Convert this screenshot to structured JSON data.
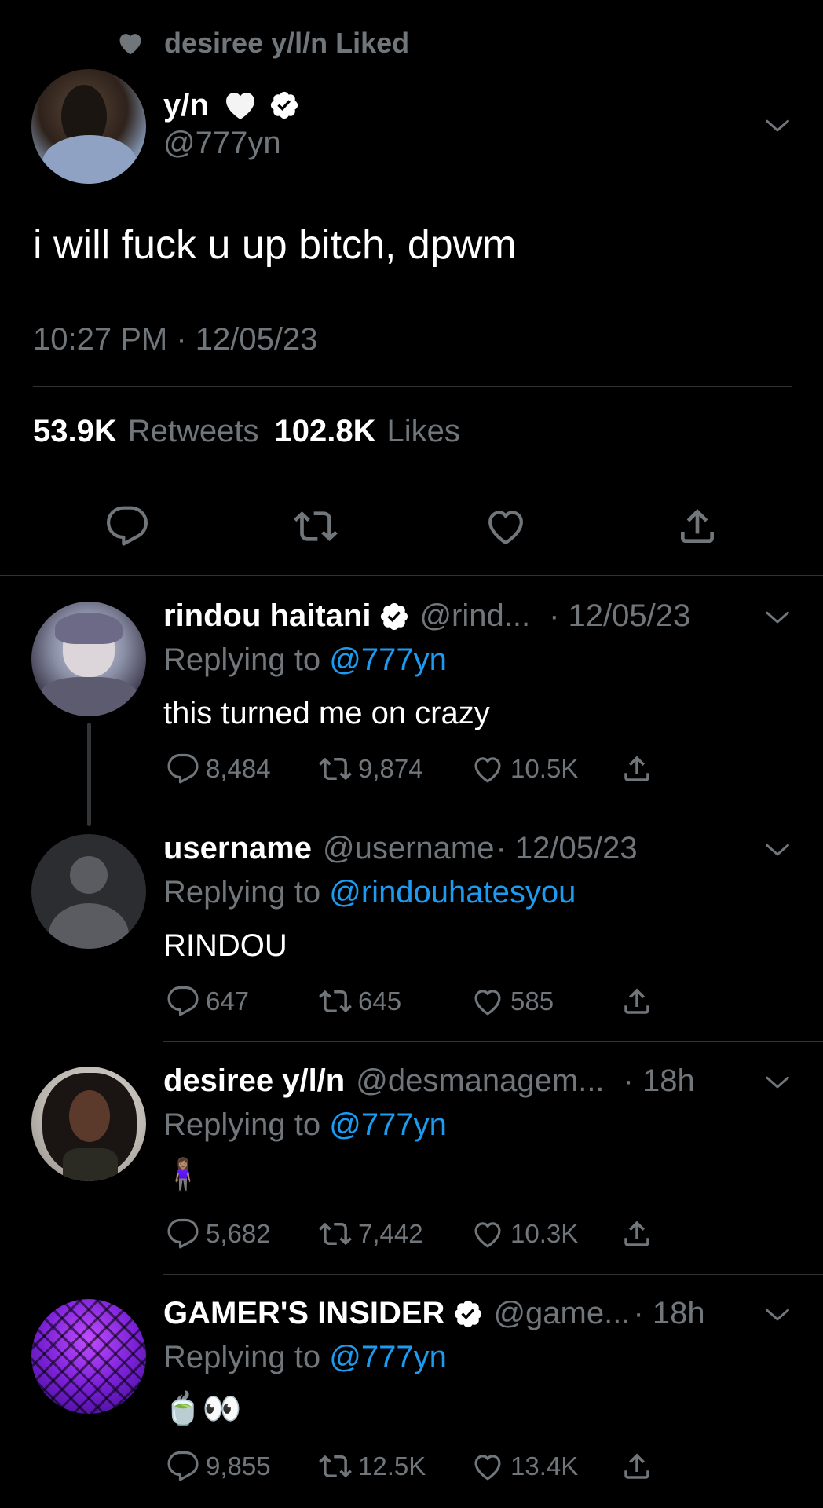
{
  "liked_banner": {
    "text": "desiree y/l/n Liked"
  },
  "main_tweet": {
    "display_name": "y/n",
    "handle": "@777yn",
    "text": "i will fuck u up bitch, dpwm",
    "timestamp": "10:27 PM · 12/05/23",
    "retweets_count": "53.9K",
    "retweets_label": "Retweets",
    "likes_count": "102.8K",
    "likes_label": "Likes"
  },
  "replies": [
    {
      "name": "rindou haitani",
      "handle": "@rind...",
      "time": "· 12/05/23",
      "replying_prefix": "Replying to",
      "replying_to": "@777yn",
      "text": "this turned me on crazy",
      "replies": "8,484",
      "retweets": "9,874",
      "likes": "10.5K"
    },
    {
      "name": "username",
      "handle": "@username",
      "time": "· 12/05/23",
      "replying_prefix": "Replying to",
      "replying_to": "@rindouhatesyou",
      "text": "RINDOU",
      "replies": "647",
      "retweets": "645",
      "likes": "585"
    },
    {
      "name": "desiree y/l/n",
      "handle": "@desmanagem...",
      "time": "· 18h",
      "replying_prefix": "Replying to",
      "replying_to": "@777yn",
      "text": "🧍🏽‍♀️",
      "replies": "5,682",
      "retweets": "7,442",
      "likes": "10.3K"
    },
    {
      "name": "GAMER'S INSIDER",
      "handle": "@game...",
      "time": "· 18h",
      "replying_prefix": "Replying to",
      "replying_to": "@777yn",
      "text": "🍵👀",
      "replies": "9,855",
      "retweets": "12.5K",
      "likes": "13.4K"
    }
  ],
  "colors": {
    "background": "#000000",
    "secondary_text": "#71767b",
    "link": "#1d9bf0",
    "verified": "#ffffff"
  },
  "icons": [
    "heart-icon",
    "verified-badge-icon",
    "chevron-down-icon",
    "reply-icon",
    "retweet-icon",
    "like-icon",
    "share-icon"
  ]
}
